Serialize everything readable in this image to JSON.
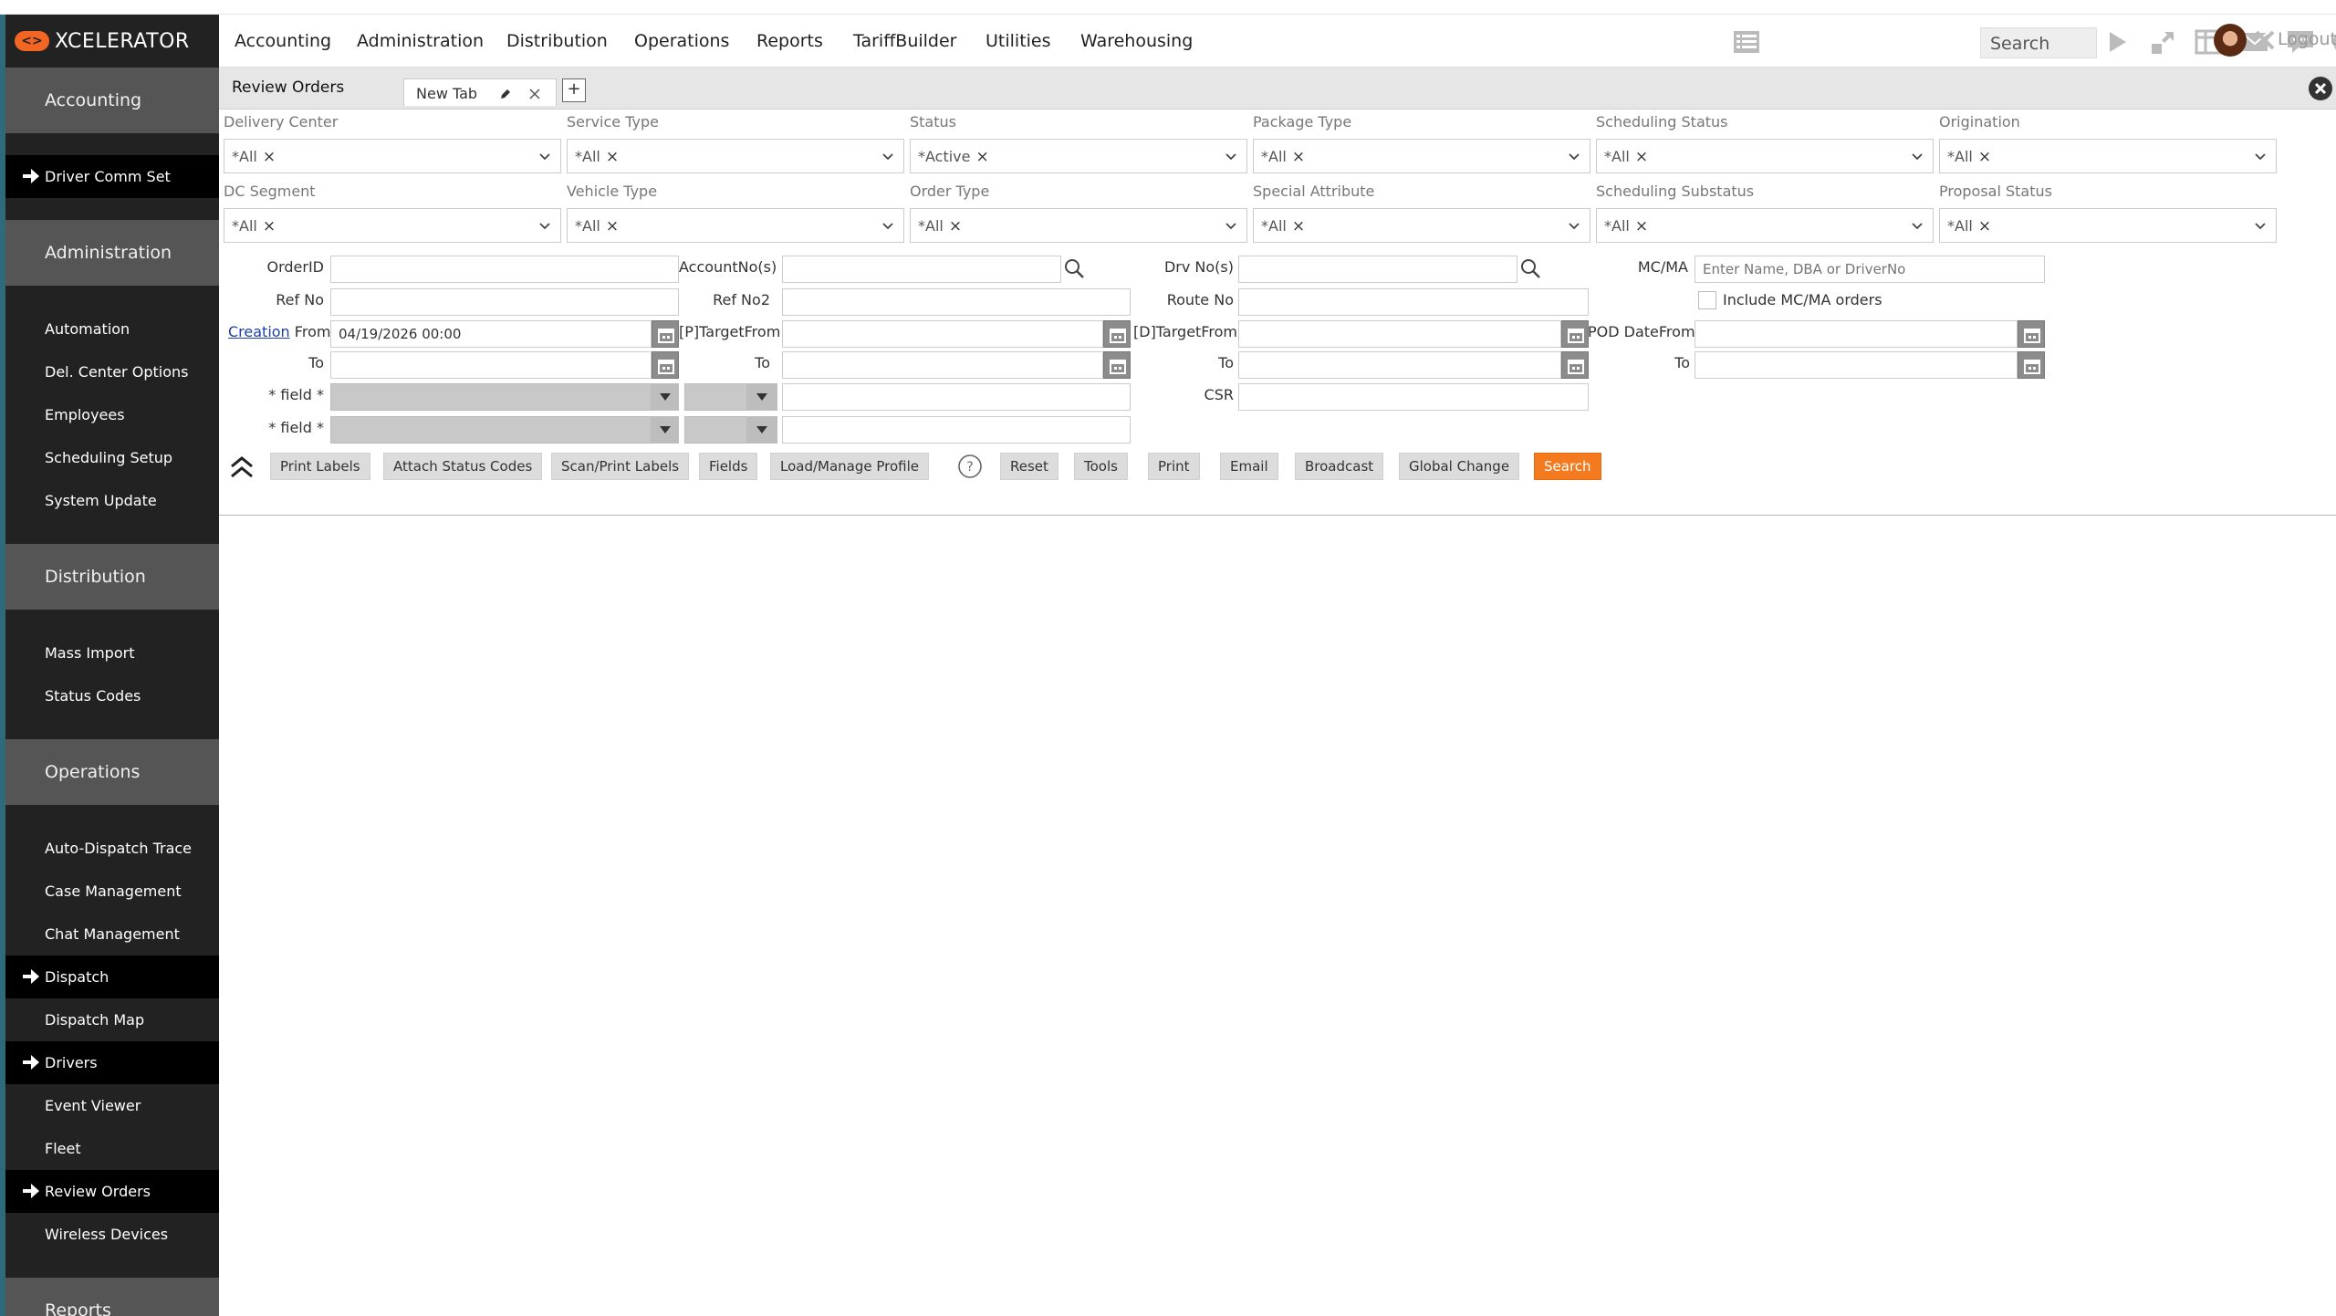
{
  "app": {
    "logo_text": "XCELERATOR"
  },
  "sidebar": {
    "sections": [
      {
        "title": "Accounting",
        "items": [
          {
            "label": "Driver Comm Set",
            "active": true
          }
        ]
      },
      {
        "title": "Administration",
        "items": [
          {
            "label": "Automation"
          },
          {
            "label": "Del. Center Options"
          },
          {
            "label": "Employees"
          },
          {
            "label": "Scheduling Setup"
          },
          {
            "label": "System Update"
          }
        ]
      },
      {
        "title": "Distribution",
        "items": [
          {
            "label": "Mass Import"
          },
          {
            "label": "Status Codes"
          }
        ]
      },
      {
        "title": "Operations",
        "items": [
          {
            "label": "Auto-Dispatch Trace"
          },
          {
            "label": "Case Management"
          },
          {
            "label": "Chat Management"
          },
          {
            "label": "Dispatch",
            "active": true
          },
          {
            "label": "Dispatch Map"
          },
          {
            "label": "Drivers",
            "active": true
          },
          {
            "label": "Event Viewer"
          },
          {
            "label": "Fleet"
          },
          {
            "label": "Review Orders",
            "active": true
          },
          {
            "label": "Wireless Devices"
          }
        ]
      },
      {
        "title": "Reports",
        "items": []
      }
    ]
  },
  "topnav": {
    "items": [
      "Accounting",
      "Administration",
      "Distribution",
      "Operations",
      "Reports",
      "TariffBuilder",
      "Utilities",
      "Warehousing"
    ],
    "search_label": "Search",
    "logout_label": "Logout"
  },
  "tabbar": {
    "title": "Review Orders",
    "tab_label": "New Tab",
    "add_label": "+"
  },
  "filters": {
    "row1": [
      {
        "label": "Delivery Center",
        "value": "*All"
      },
      {
        "label": "Service Type",
        "value": "*All"
      },
      {
        "label": "Status",
        "value": "*Active"
      },
      {
        "label": "Package Type",
        "value": "*All"
      },
      {
        "label": "Scheduling Status",
        "value": "*All"
      },
      {
        "label": "Origination",
        "value": "*All"
      }
    ],
    "row2": [
      {
        "label": "DC Segment",
        "value": "*All"
      },
      {
        "label": "Vehicle Type",
        "value": "*All"
      },
      {
        "label": "Order Type",
        "value": "*All"
      },
      {
        "label": "Special Attribute",
        "value": "*All"
      },
      {
        "label": "Scheduling Substatus",
        "value": "*All"
      },
      {
        "label": "Proposal Status",
        "value": "*All"
      }
    ],
    "chip_remove": "×"
  },
  "fields": {
    "order_id": "OrderID",
    "account_no": "AccountNo(s)",
    "drv_no": "Drv No(s)",
    "mcma": "MC/MA",
    "mcma_placeholder": "Enter Name, DBA or DriverNo",
    "ref_no": "Ref No",
    "ref_no2": "Ref No2",
    "route_no": "Route No",
    "include_mcma": "Include MC/MA orders",
    "creation": "Creation",
    "from": "From",
    "creation_from_value": "04/19/2026 00:00",
    "p_target_from": "[P]TargetFrom",
    "d_target_from": "[D]TargetFrom",
    "pod_date_from": "POD DateFrom",
    "to": "To",
    "field_label": "* field *",
    "csr": "CSR"
  },
  "buttons": {
    "print_labels": "Print Labels",
    "attach_status_codes": "Attach Status Codes",
    "scan_print_labels": "Scan/Print Labels",
    "fields": "Fields",
    "load_manage_profile": "Load/Manage Profile",
    "reset": "Reset",
    "tools": "Tools",
    "print": "Print",
    "email": "Email",
    "broadcast": "Broadcast",
    "global_change": "Global Change",
    "search": "Search"
  },
  "colors": {
    "accent": "#f47a20",
    "sidebar_bg": "#222222",
    "section_bg": "#555555",
    "link": "#1a3fa6"
  }
}
